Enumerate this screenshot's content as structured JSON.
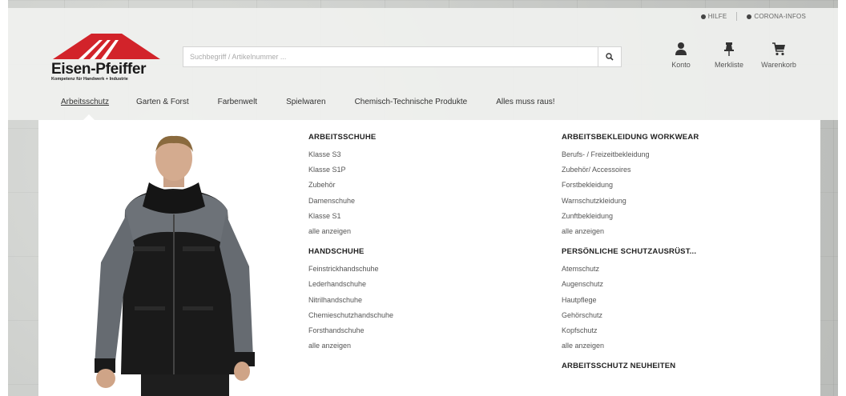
{
  "toplinks": {
    "help": "HILFE",
    "corona": "CORONA-INFOS"
  },
  "logo": {
    "name": "Eisen-Pfeiffer",
    "tagline": "Kompetenz für Handwerk + Industrie"
  },
  "search": {
    "placeholder": "Suchbegriff / Artikelnummer ...",
    "icon": "search-icon"
  },
  "actions": [
    {
      "label": "Konto",
      "icon": "user-icon"
    },
    {
      "label": "Merkliste",
      "icon": "pin-icon"
    },
    {
      "label": "Warenkorb",
      "icon": "cart-icon"
    }
  ],
  "nav": [
    {
      "label": "Arbeitsschutz",
      "active": true
    },
    {
      "label": "Garten & Forst"
    },
    {
      "label": "Farbenwelt"
    },
    {
      "label": "Spielwaren"
    },
    {
      "label": "Chemisch-Technische Produkte"
    },
    {
      "label": "Alles muss raus!"
    }
  ],
  "menu": {
    "col1": [
      {
        "title": "ARBEITSSCHUHE",
        "links": [
          "Klasse S3",
          "Klasse S1P",
          "Zubehör",
          "Damenschuhe",
          "Klasse S1",
          "alle anzeigen"
        ]
      },
      {
        "title": "HANDSCHUHE",
        "links": [
          "Feinstrickhandschuhe",
          "Lederhandschuhe",
          "Nitrilhandschuhe",
          "Chemieschutzhandschuhe",
          "Forsthandschuhe",
          "alle anzeigen"
        ]
      }
    ],
    "col2": [
      {
        "title": "ARBEITSBEKLEIDUNG WORKWEAR",
        "links": [
          "Berufs- / Freizeitbekleidung",
          "Zubehör/ Accessoires",
          "Forstbekleidung",
          "Warnschutzkleidung",
          "Zunftbekleidung",
          "alle anzeigen"
        ]
      },
      {
        "title": "PERSÖNLICHE SCHUTZAUSRÜST...",
        "links": [
          "Atemschutz",
          "Augenschutz",
          "Hautpflege",
          "Gehörschutz",
          "Kopfschutz",
          "alle anzeigen"
        ]
      },
      {
        "title": "ARBEITSSCHUTZ NEUHEITEN",
        "links": []
      }
    ]
  },
  "colors": {
    "logo_red": "#d2232a",
    "panel": "#ffffff",
    "header": "#f0f1ef"
  }
}
